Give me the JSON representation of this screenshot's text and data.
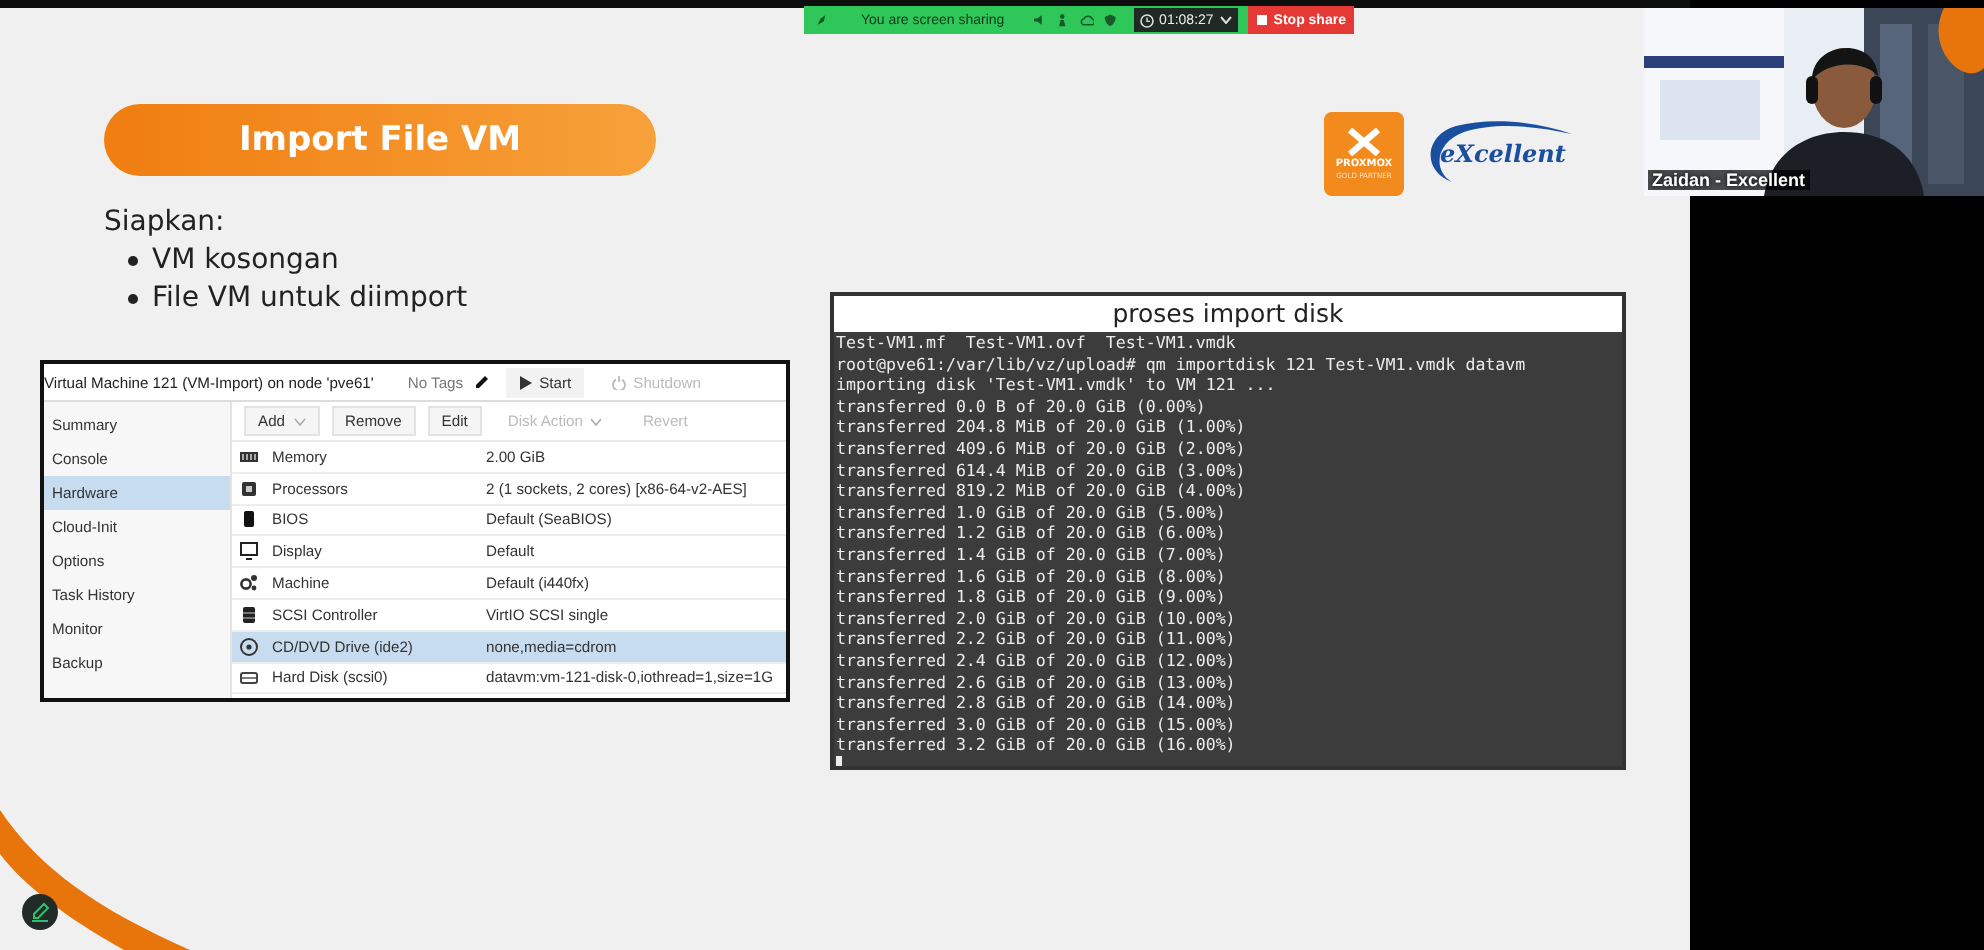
{
  "share_bar": {
    "status": "You are screen sharing",
    "timer": "01:08:27",
    "stop_button": "Stop share"
  },
  "slide": {
    "title": "Import File VM",
    "logos": {
      "proxmox_name": "PROXMOX",
      "proxmox_badge": "GOLD PARTNER",
      "excellent": "eXcellent"
    },
    "intro": "Siapkan:",
    "bullets": [
      "VM kosongan",
      "File VM untuk diimport"
    ],
    "vm_screenshot": {
      "title": "Virtual Machine 121 (VM-Import) on node 'pve61'",
      "tags": "No Tags",
      "header_buttons": [
        {
          "kind": "start",
          "label": "Start",
          "disabled": false
        },
        {
          "kind": "shutdown",
          "label": "Shutdown",
          "disabled": true
        }
      ],
      "nav": [
        {
          "label": "Summary",
          "selected": false
        },
        {
          "label": "Console",
          "selected": false
        },
        {
          "label": "Hardware",
          "selected": true
        },
        {
          "label": "Cloud-Init",
          "selected": false
        },
        {
          "label": "Options",
          "selected": false
        },
        {
          "label": "Task History",
          "selected": false
        },
        {
          "label": "Monitor",
          "selected": false
        },
        {
          "label": "Backup",
          "selected": false
        }
      ],
      "toolbar": [
        {
          "label": "Add",
          "dropdown": true,
          "disabled": false
        },
        {
          "label": "Remove",
          "dropdown": false,
          "disabled": false
        },
        {
          "label": "Edit",
          "dropdown": false,
          "disabled": false
        },
        {
          "label": "Disk Action",
          "dropdown": true,
          "disabled": true
        },
        {
          "label": "Revert",
          "dropdown": false,
          "disabled": true
        }
      ],
      "rows": [
        {
          "kind": "memory",
          "name": "Memory",
          "value": "2.00 GiB",
          "selected": false
        },
        {
          "kind": "processor",
          "name": "Processors",
          "value": "2 (1 sockets, 2 cores) [x86-64-v2-AES]",
          "selected": false
        },
        {
          "kind": "bios",
          "name": "BIOS",
          "value": "Default (SeaBIOS)",
          "selected": false
        },
        {
          "kind": "display",
          "name": "Display",
          "value": "Default",
          "selected": false
        },
        {
          "kind": "machine",
          "name": "Machine",
          "value": "Default (i440fx)",
          "selected": false
        },
        {
          "kind": "controller",
          "name": "SCSI Controller",
          "value": "VirtIO SCSI single",
          "selected": false
        },
        {
          "kind": "cdrom",
          "name": "CD/DVD Drive (ide2)",
          "value": "none,media=cdrom",
          "selected": true
        },
        {
          "kind": "disk",
          "name": "Hard Disk (scsi0)",
          "value": "datavm:vm-121-disk-0,iothread=1,size=1G",
          "selected": false
        }
      ]
    },
    "terminal": {
      "title": "proses import disk",
      "lines": [
        "Test-VM1.mf  Test-VM1.ovf  Test-VM1.vmdk",
        "root@pve61:/var/lib/vz/upload# qm importdisk 121 Test-VM1.vmdk datavm",
        "importing disk 'Test-VM1.vmdk' to VM 121 ...",
        "transferred 0.0 B of 20.0 GiB (0.00%)",
        "transferred 204.8 MiB of 20.0 GiB (1.00%)",
        "transferred 409.6 MiB of 20.0 GiB (2.00%)",
        "transferred 614.4 MiB of 20.0 GiB (3.00%)",
        "transferred 819.2 MiB of 20.0 GiB (4.00%)",
        "transferred 1.0 GiB of 20.0 GiB (5.00%)",
        "transferred 1.2 GiB of 20.0 GiB (6.00%)",
        "transferred 1.4 GiB of 20.0 GiB (7.00%)",
        "transferred 1.6 GiB of 20.0 GiB (8.00%)",
        "transferred 1.8 GiB of 20.0 GiB (9.00%)",
        "transferred 2.0 GiB of 20.0 GiB (10.00%)",
        "transferred 2.2 GiB of 20.0 GiB (11.00%)",
        "transferred 2.4 GiB of 20.0 GiB (12.00%)",
        "transferred 2.6 GiB of 20.0 GiB (13.00%)",
        "transferred 2.8 GiB of 20.0 GiB (14.00%)",
        "transferred 3.0 GiB of 20.0 GiB (15.00%)",
        "transferred 3.2 GiB of 20.0 GiB (16.00%)"
      ]
    }
  },
  "video": {
    "name": "Zaidan - Excellent"
  }
}
